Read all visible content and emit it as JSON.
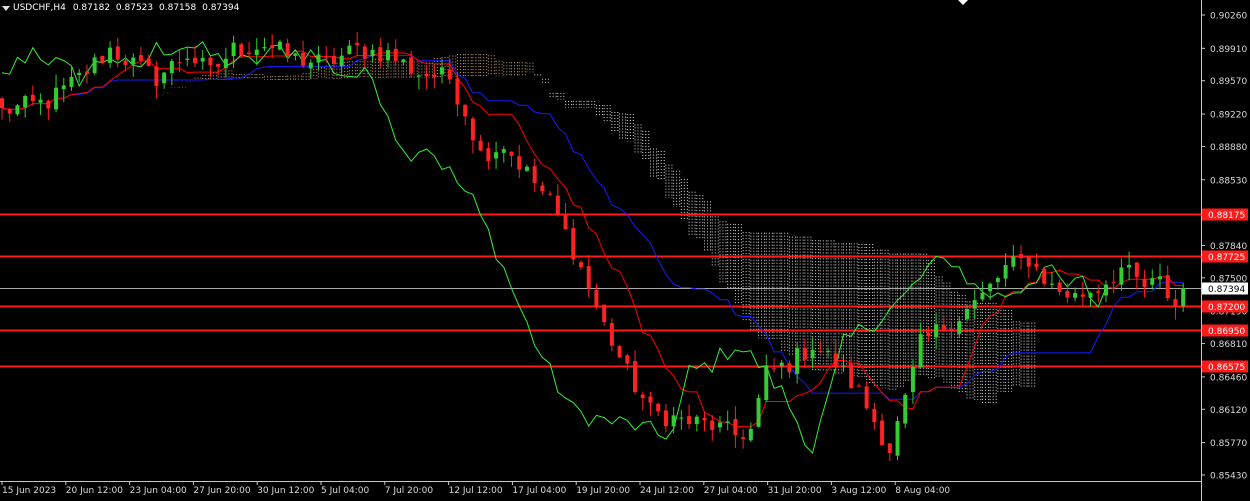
{
  "header": {
    "symbol": "USDCHF,H4",
    "open": "0.87182",
    "high": "0.87523",
    "low": "0.87158",
    "close": "0.87394"
  },
  "price_axis": {
    "labels": [
      "0.90260",
      "0.89910",
      "0.89570",
      "0.89220",
      "0.88880",
      "0.88530",
      "0.87840",
      "0.87500",
      "0.87150",
      "0.86810",
      "0.86460",
      "0.86120",
      "0.85770",
      "0.85430"
    ]
  },
  "time_axis": {
    "labels": [
      "15 Jun 2023",
      "20 Jun 12:00",
      "23 Jun 04:00",
      "27 Jun 20:00",
      "30 Jun 12:00",
      "5 Jul 04:00",
      "7 Jul 20:00",
      "12 Jul 12:00",
      "17 Jul 04:00",
      "19 Jul 20:00",
      "24 Jul 12:00",
      "27 Jul 04:00",
      "31 Jul 20:00",
      "3 Aug 12:00",
      "8 Aug 04:00"
    ]
  },
  "levels": [
    {
      "label": "0.88175",
      "color": "#ff1a1a"
    },
    {
      "label": "0.87725",
      "color": "#ff1a1a"
    },
    {
      "label": "0.87200",
      "color": "#ff1a1a"
    },
    {
      "label": "0.86950",
      "color": "#ff1a1a"
    },
    {
      "label": "0.86575",
      "color": "#ff1a1a"
    }
  ],
  "current_price": {
    "label": "0.87394",
    "color": "#ffffff"
  },
  "colors": {
    "background": "#000000",
    "bull_candle": "#33cc33",
    "bear_candle": "#ff2222",
    "tenkan": "#ff0000",
    "kijun": "#1a1aff",
    "chikou": "#33ee33",
    "cloud_bear": "#ffffff",
    "cloud_bull": "#f5c08a",
    "level_line": "#ff1a1a"
  },
  "chart_data": {
    "type": "candlestick",
    "indicator": "ichimoku",
    "ylim": [
      0.8538,
      0.904
    ],
    "current": 0.87394,
    "candles_anchor_path": [
      [
        0,
        0.8925
      ],
      [
        6,
        0.8935
      ],
      [
        10,
        0.896
      ],
      [
        14,
        0.899
      ],
      [
        17,
        0.8975
      ],
      [
        20,
        0.896
      ],
      [
        24,
        0.8985
      ],
      [
        27,
        0.8965
      ],
      [
        30,
        0.899
      ],
      [
        34,
        0.8995
      ],
      [
        38,
        0.898
      ],
      [
        42,
        0.8975
      ],
      [
        46,
        0.899
      ],
      [
        50,
        0.8985
      ],
      [
        54,
        0.8965
      ],
      [
        58,
        0.896
      ],
      [
        60,
        0.8925
      ],
      [
        62,
        0.888
      ],
      [
        65,
        0.889
      ],
      [
        68,
        0.886
      ],
      [
        71,
        0.883
      ],
      [
        74,
        0.878
      ],
      [
        76,
        0.874
      ],
      [
        78,
        0.87
      ],
      [
        81,
        0.865
      ],
      [
        84,
        0.861
      ],
      [
        88,
        0.86
      ],
      [
        92,
        0.8595
      ],
      [
        95,
        0.8585
      ],
      [
        97,
        0.859
      ],
      [
        99,
        0.865
      ],
      [
        102,
        0.866
      ],
      [
        105,
        0.868
      ],
      [
        108,
        0.866
      ],
      [
        111,
        0.863
      ],
      [
        113,
        0.86
      ],
      [
        115,
        0.857
      ],
      [
        117,
        0.862
      ],
      [
        119,
        0.868
      ],
      [
        122,
        0.87
      ],
      [
        124,
        0.871
      ],
      [
        127,
        0.873
      ],
      [
        130,
        0.876
      ],
      [
        133,
        0.877
      ],
      [
        136,
        0.874
      ],
      [
        139,
        0.873
      ],
      [
        142,
        0.874
      ],
      [
        145,
        0.876
      ],
      [
        148,
        0.874
      ],
      [
        150,
        0.8745
      ],
      [
        152,
        0.872
      ],
      [
        153,
        0.8739
      ]
    ]
  }
}
